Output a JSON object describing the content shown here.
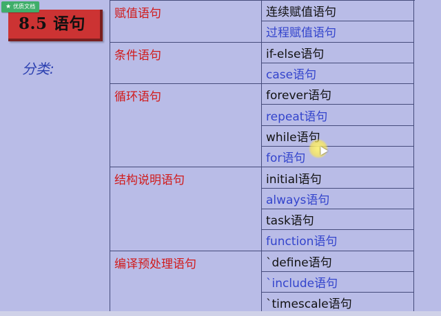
{
  "badge": {
    "icon": "star-icon",
    "label": "优质文档"
  },
  "slide": {
    "title": "8.5 语句",
    "category_label": "分类:"
  },
  "table": {
    "groups": [
      {
        "category": "赋值语句",
        "items": [
          "连续赋值语句",
          "过程赋值语句"
        ]
      },
      {
        "category": "条件语句",
        "items": [
          "if-else语句",
          "case语句"
        ]
      },
      {
        "category": "循环语句",
        "items": [
          "forever语句",
          "repeat语句",
          "while语句",
          "for语句"
        ]
      },
      {
        "category": "结构说明语句",
        "items": [
          "initial语句",
          "always语句",
          "task语句",
          "function语句"
        ]
      },
      {
        "category": "编译预处理语句",
        "items": [
          "`define语句",
          "`include语句",
          "`timescale语句"
        ]
      }
    ]
  },
  "colors": {
    "background": "#b9bce7",
    "title_box": "#cc3333",
    "category_text": "#d11a1a",
    "item_dark": "#111111",
    "item_blue": "#3344cc",
    "label_blue": "#2b3fb0",
    "badge_green": "#3fae6a"
  }
}
